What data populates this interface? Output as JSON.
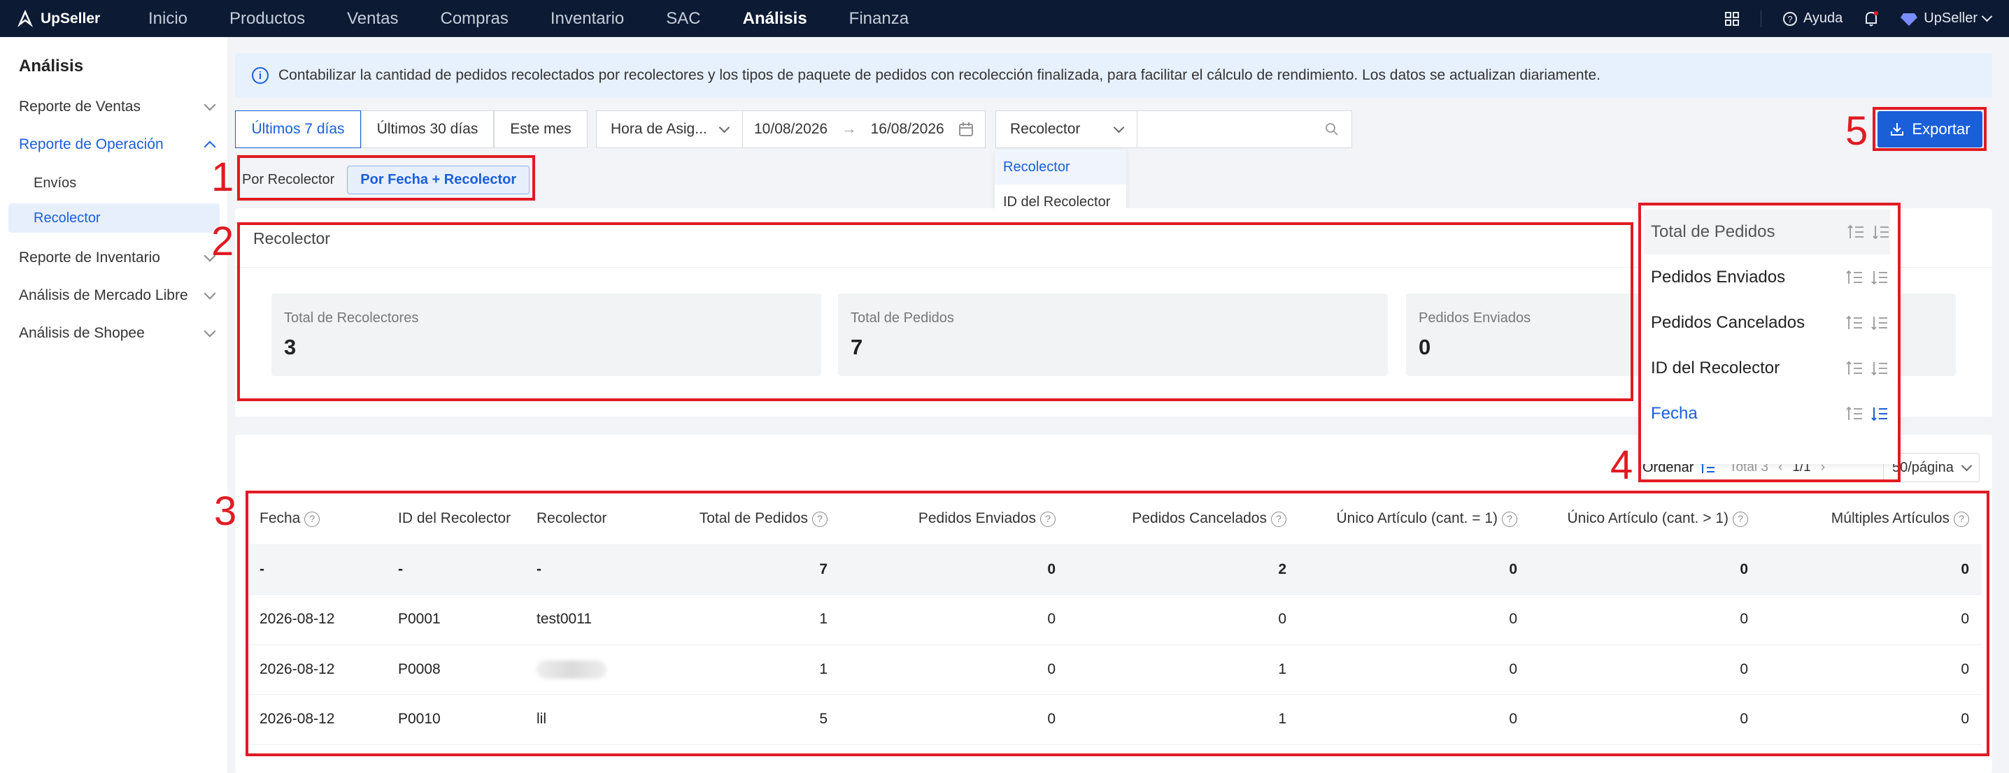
{
  "nav": {
    "brand": "UpSeller",
    "items": [
      "Inicio",
      "Productos",
      "Ventas",
      "Compras",
      "Inventario",
      "SAC",
      "Análisis",
      "Finanza"
    ],
    "active": "Análisis",
    "help": "Ayuda",
    "account": "UpSeller"
  },
  "sidebar": {
    "title": "Análisis",
    "items": [
      {
        "label": "Reporte de Ventas"
      },
      {
        "label": "Reporte de Operación"
      },
      {
        "label": "Envíos"
      },
      {
        "label": "Recolector"
      },
      {
        "label": "Reporte de Inventario"
      },
      {
        "label": "Análisis de Mercado Libre"
      },
      {
        "label": "Análisis de Shopee"
      }
    ]
  },
  "banner": {
    "text": "Contabilizar la cantidad de pedidos recolectados por recolectores y los tipos de paquete de pedidos con recolección finalizada, para facilitar el cálculo de rendimiento. Los datos se actualizan diariamente."
  },
  "filters": {
    "ranges": [
      "Últimos 7 días",
      "Últimos 30 días",
      "Este mes"
    ],
    "time_type": "Hora de Asig...",
    "date_from": "10/08/2026",
    "date_to": "16/08/2026",
    "search_field": "Recolector",
    "search_options": [
      "Recolector",
      "ID del Recolector"
    ],
    "export": "Exportar"
  },
  "view_toggle": {
    "by_collector": "Por Recolector",
    "by_date_collector": "Por Fecha + Recolector"
  },
  "summary": {
    "title": "Recolector",
    "stats": [
      {
        "label": "Total de Recolectores",
        "value": "3"
      },
      {
        "label": "Total de Pedidos",
        "value": "7"
      },
      {
        "label": "Pedidos Enviados",
        "value": "0"
      }
    ]
  },
  "sort_panel": {
    "items": [
      "Total de Pedidos",
      "Pedidos Enviados",
      "Pedidos Cancelados",
      "ID del Recolector",
      "Fecha"
    ],
    "active": "Fecha"
  },
  "toolbar": {
    "order": "Ordenar",
    "total": "Total 3",
    "page": "1/1",
    "per_page": "50/página"
  },
  "table": {
    "headers": [
      "Fecha",
      "ID del Recolector",
      "Recolector",
      "Total de Pedidos",
      "Pedidos Enviados",
      "Pedidos Cancelados",
      "Único Artículo (cant. = 1)",
      "Único Artículo (cant. > 1)",
      "Múltiples Artículos"
    ],
    "total_row": [
      "-",
      "-",
      "-",
      "7",
      "0",
      "2",
      "0",
      "0",
      "0"
    ],
    "rows": [
      [
        "2026-08-12",
        "P0001",
        "test0011",
        "1",
        "0",
        "0",
        "0",
        "0",
        "0"
      ],
      [
        "2026-08-12",
        "P0008",
        "",
        "1",
        "0",
        "1",
        "0",
        "0",
        "0"
      ],
      [
        "2026-08-12",
        "P0010",
        "lil",
        "5",
        "0",
        "1",
        "0",
        "0",
        "0"
      ]
    ]
  },
  "annotations": [
    "1",
    "2",
    "3",
    "4",
    "5"
  ],
  "colors": {
    "accent": "#1a5fd8",
    "nav_bg": "#0c1a34",
    "annotation": "#e01b22"
  }
}
